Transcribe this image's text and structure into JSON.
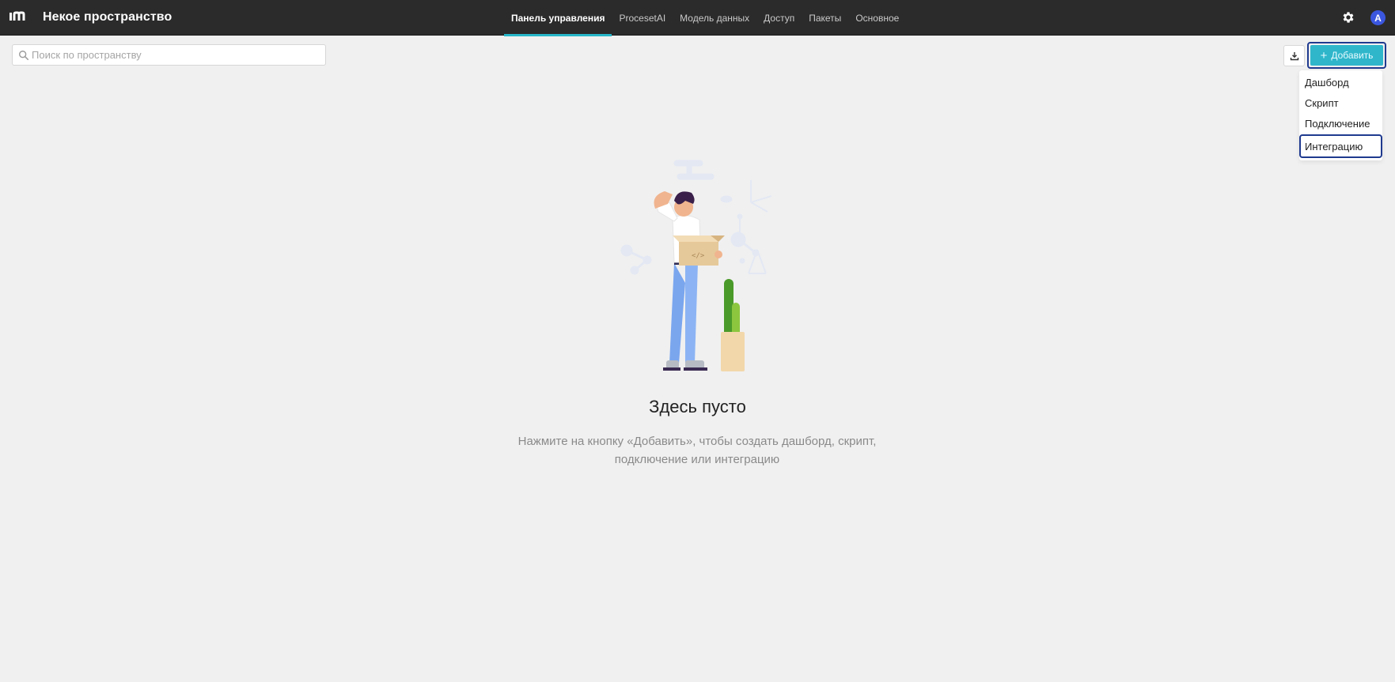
{
  "header": {
    "space_title": "Некое пространство",
    "tabs": [
      {
        "label": "Панель управления",
        "active": true
      },
      {
        "label": "ProcesetAI",
        "active": false
      },
      {
        "label": "Модель данных",
        "active": false
      },
      {
        "label": "Доступ",
        "active": false
      },
      {
        "label": "Пакеты",
        "active": false
      },
      {
        "label": "Основное",
        "active": false
      }
    ],
    "settings_icon": "gear-icon",
    "avatar_letter": "A",
    "avatar_color": "#3b57e0"
  },
  "search": {
    "placeholder": "Поиск по пространству",
    "value": ""
  },
  "toolbar": {
    "download_icon": "download-icon",
    "add_label": "Добавить",
    "add_color": "#2fb6cb"
  },
  "add_menu": {
    "items": [
      {
        "label": "Дашборд"
      },
      {
        "label": "Скрипт"
      },
      {
        "label": "Подключение"
      },
      {
        "label": "Интеграцию",
        "selected": true
      }
    ]
  },
  "empty_state": {
    "title": "Здесь пусто",
    "description": "Нажмите на кнопку «Добавить», чтобы создать дашборд, скрипт, подключение или интеграцию"
  },
  "colors": {
    "topbar_bg": "#2b2b2b",
    "accent": "#26b7c9",
    "focus_outline": "#1f3a8f"
  }
}
